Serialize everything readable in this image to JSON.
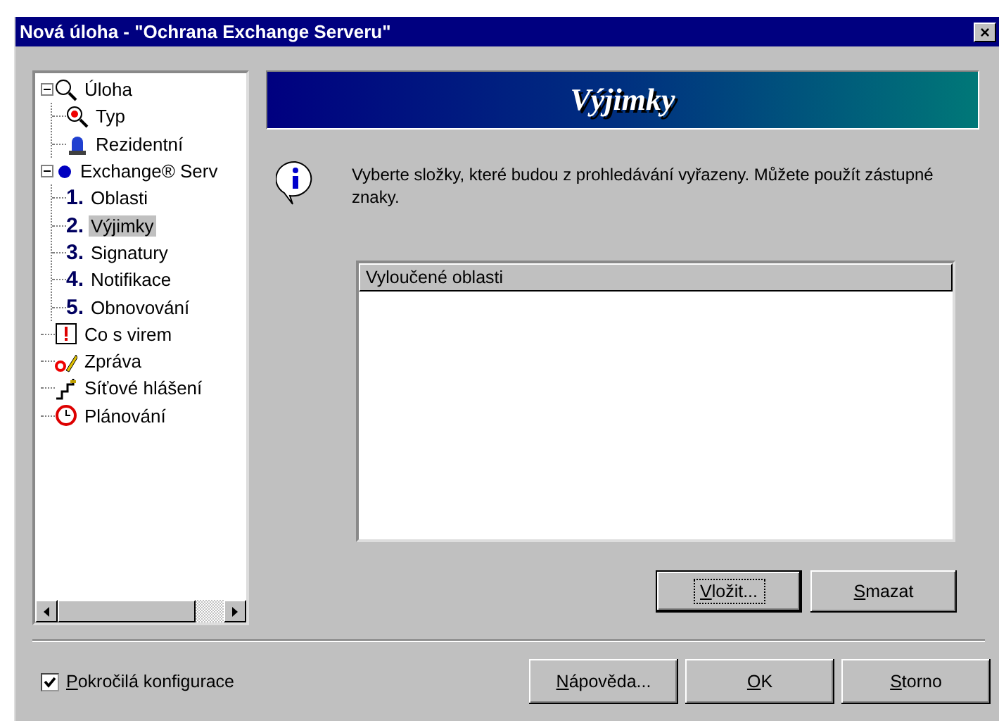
{
  "window": {
    "title": "Nová úloha - \"Ochrana Exchange Serveru\"",
    "close": "×"
  },
  "tree": [
    {
      "label": "Úloha",
      "kind": "magnifier",
      "expanded": true,
      "selected": false,
      "children": [
        {
          "label": "Typ",
          "kind": "question",
          "selected": false
        },
        {
          "label": "Rezidentní",
          "kind": "beacon",
          "selected": false
        }
      ]
    },
    {
      "label": "Exchange® Serv",
      "kind": "dot",
      "expanded": true,
      "selected": false,
      "children": [
        {
          "number": "1.",
          "label": "Oblasti",
          "kind": "number",
          "selected": false
        },
        {
          "number": "2.",
          "label": "Výjimky",
          "kind": "number",
          "selected": true
        },
        {
          "number": "3.",
          "label": "Signatury",
          "kind": "number",
          "selected": false
        },
        {
          "number": "4.",
          "label": "Notifikace",
          "kind": "number",
          "selected": false
        },
        {
          "number": "5.",
          "label": "Obnovování",
          "kind": "number",
          "selected": false
        }
      ]
    },
    {
      "label": "Co s virem",
      "kind": "alert",
      "selected": false
    },
    {
      "label": "Zpráva",
      "kind": "pen",
      "selected": false
    },
    {
      "label": "Síťové hlášení",
      "kind": "network",
      "selected": false
    },
    {
      "label": "Plánování",
      "kind": "clock",
      "selected": false
    }
  ],
  "banner": {
    "title": "Výjimky"
  },
  "info": "Vyberte složky, které budou z prohledávání vyřazeny. Můžete použít zástupné znaky.",
  "list": {
    "columns": [
      "Vyloučené oblasti"
    ]
  },
  "list_buttons": [
    {
      "label": "Vložit...",
      "focused": true
    },
    {
      "label": "Smazat",
      "focused": false
    }
  ],
  "advanced": {
    "label": "Pokročilá konfigurace",
    "checked": true
  },
  "buttons": [
    "Nápověda...",
    "OK",
    "Storno"
  ]
}
